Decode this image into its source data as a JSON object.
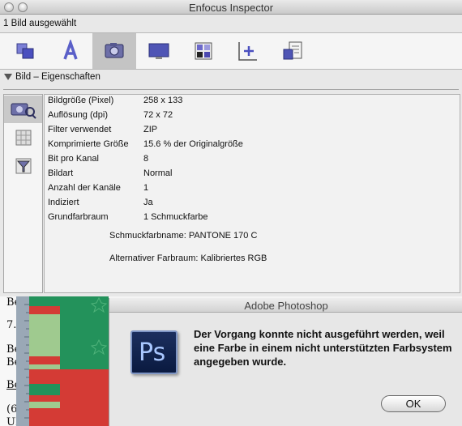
{
  "inspector": {
    "window_title": "Enfocus Inspector",
    "selection_count": "1 Bild ausgewählt",
    "toolbar": [
      {
        "name": "objects-icon"
      },
      {
        "name": "text-icon"
      },
      {
        "name": "image-icon"
      },
      {
        "name": "document-icon"
      },
      {
        "name": "colors-icon"
      },
      {
        "name": "position-icon"
      },
      {
        "name": "prepress-icon"
      }
    ],
    "section_title": "Bild – Eigenschaften",
    "side_tabs": [
      {
        "name": "image-properties-icon"
      },
      {
        "name": "image-resolution-icon"
      },
      {
        "name": "image-filter-icon"
      }
    ],
    "properties": [
      {
        "label": "Bildgröße (Pixel)",
        "value": "258 x 133"
      },
      {
        "label": "Auflösung (dpi)",
        "value": "72 x 72"
      },
      {
        "label": "Filter verwendet",
        "value": "ZIP"
      },
      {
        "label": "Komprimierte Größe",
        "value": "15.6 % der Originalgröße"
      },
      {
        "label": "Bit pro Kanal",
        "value": "8"
      },
      {
        "label": "Bildart",
        "value": "Normal"
      },
      {
        "label": "Anzahl der Kanäle",
        "value": "1"
      },
      {
        "label": "Indiziert",
        "value": "Ja"
      },
      {
        "label": "Grundfarbraum",
        "value": "1 Schmuckfarbe"
      }
    ],
    "spot_color_name": "Schmuckfarbname: PANTONE 170 C",
    "alternative_space": "Alternativer Farbraum: Kalibriertes RGB"
  },
  "background_doc": {
    "lines": [
      "Be",
      "7.",
      "Be",
      "Be",
      "Be",
      "(6",
      "UI"
    ]
  },
  "dialog": {
    "title": "Adobe Photoshop",
    "app_icon_text": "Ps",
    "message": "Der Vorgang konnte nicht ausgeführt werden, weil eine Farbe in einem nicht unterstützten Farbsystem angegeben wurde.",
    "ok_label": "OK"
  },
  "colors": {
    "artwork_green": "#23925b",
    "artwork_red": "#d43b35",
    "selection_gray": "#c4c4c4"
  }
}
